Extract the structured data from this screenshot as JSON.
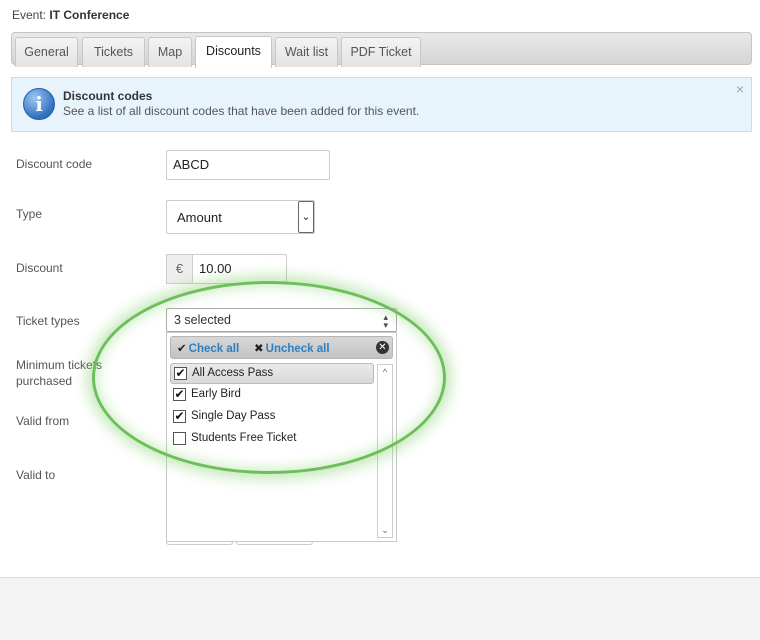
{
  "event": {
    "prefix": "Event:",
    "name": "IT Conference"
  },
  "tabs": [
    {
      "label": "General"
    },
    {
      "label": "Tickets"
    },
    {
      "label": "Map"
    },
    {
      "label": "Discounts"
    },
    {
      "label": "Wait list"
    },
    {
      "label": "PDF Ticket"
    }
  ],
  "active_tab": "Discounts",
  "info": {
    "title": "Discount codes",
    "text": "See a list of all discount codes that have been added for this event.",
    "close_icon": "×"
  },
  "form": {
    "discount_code": {
      "label": "Discount code",
      "value": "ABCD"
    },
    "type": {
      "label": "Type",
      "value": "Amount"
    },
    "discount": {
      "label": "Discount",
      "currency": "€",
      "value": "10.00"
    },
    "ticket_types": {
      "label": "Ticket types",
      "value": "3 selected",
      "check_all": "Check all",
      "uncheck_all": "Uncheck all",
      "options": [
        {
          "label": "All Access Pass",
          "checked": true
        },
        {
          "label": "Early Bird",
          "checked": true
        },
        {
          "label": "Single Day Pass",
          "checked": true
        },
        {
          "label": "Students Free Ticket",
          "checked": false
        }
      ]
    },
    "min_tickets": {
      "label_line1": "Minimum tickets",
      "label_line2": "purchased"
    },
    "valid_from": {
      "label": "Valid from"
    },
    "valid_to": {
      "label": "Valid to"
    }
  },
  "colors": {
    "annotation": "#6cbf5a",
    "link": "#2e7fbf",
    "info_bg": "#e7f4fb"
  }
}
